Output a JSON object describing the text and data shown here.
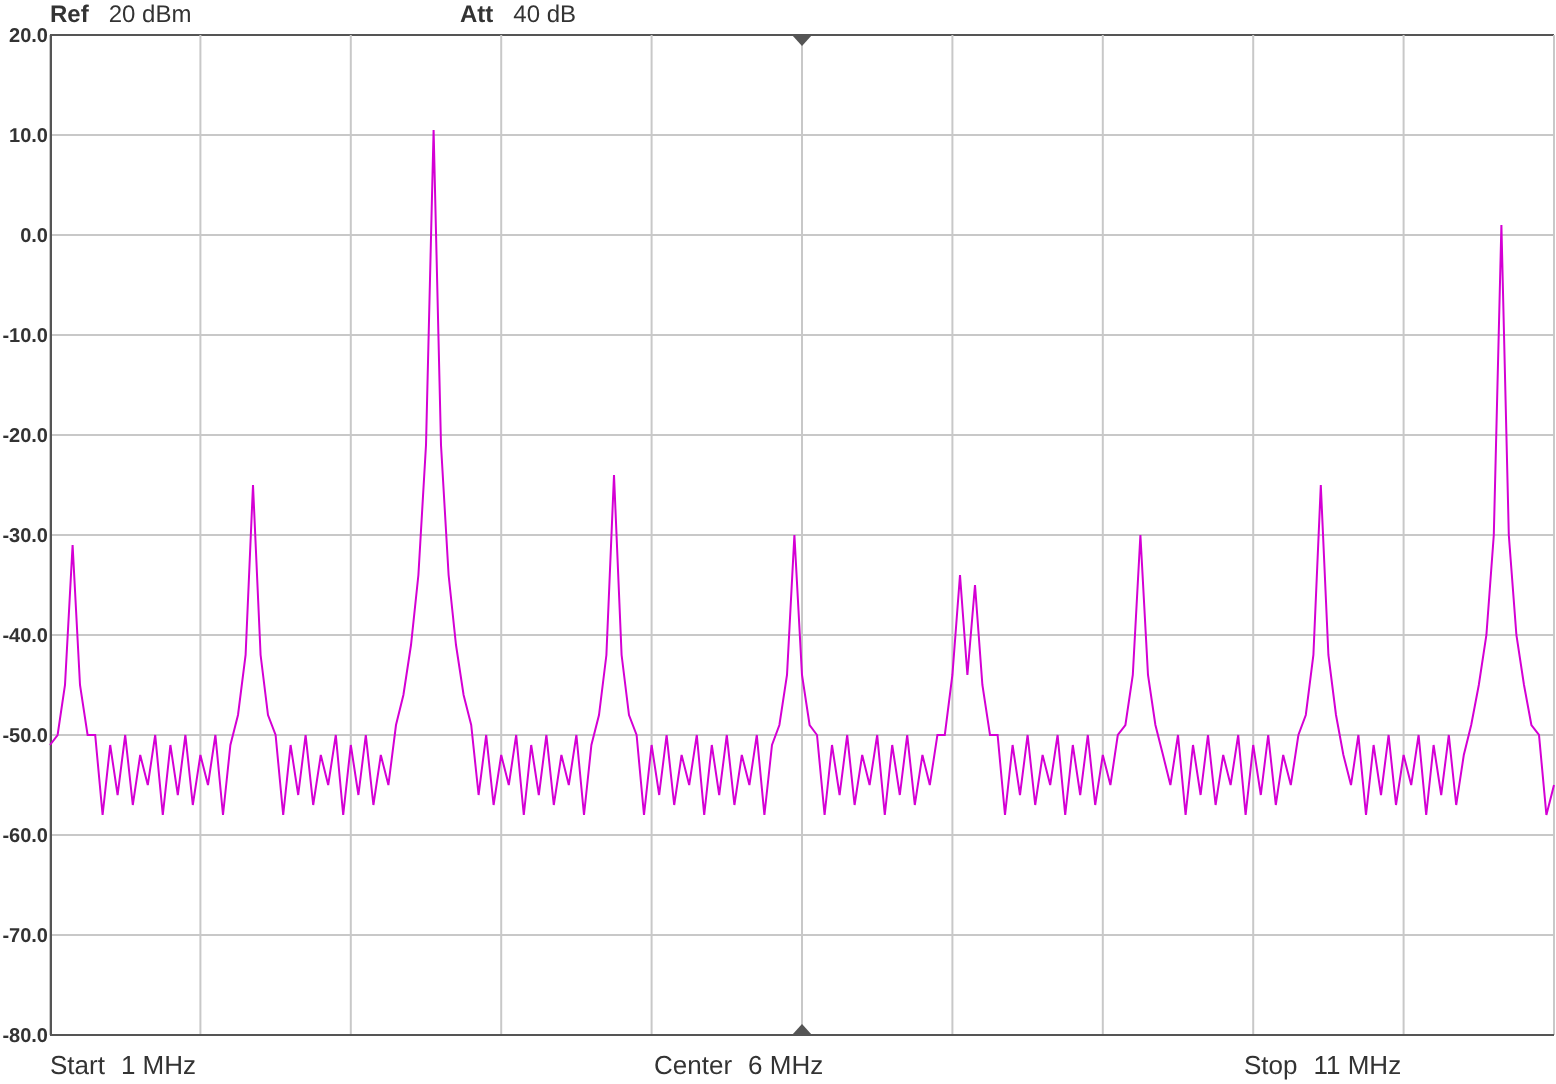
{
  "header": [
    {
      "label": "Ref",
      "value": "20 dBm"
    },
    {
      "label": "Att",
      "value": "40 dB"
    }
  ],
  "spectrum": {
    "chart_data": {
      "type": "line",
      "grid": true,
      "ylim": [
        -80,
        20
      ],
      "yticks": [
        {
          "value": 20,
          "label": "20.0"
        },
        {
          "value": 10,
          "label": "10.0"
        },
        {
          "value": 0,
          "label": "0.0"
        },
        {
          "value": -10,
          "label": "-10.0"
        },
        {
          "value": -20,
          "label": "-20.0"
        },
        {
          "value": -30,
          "label": "-30.0"
        },
        {
          "value": -40,
          "label": "-40.0"
        },
        {
          "value": -50,
          "label": "-50.0"
        },
        {
          "value": -60,
          "label": "-60.0"
        },
        {
          "value": -70,
          "label": "-70.0"
        },
        {
          "value": -80,
          "label": "-80.0"
        }
      ],
      "categories": [
        null,
        null,
        null,
        null,
        null,
        null,
        null,
        null,
        null,
        null,
        null,
        null,
        null,
        null,
        null,
        null,
        null,
        null,
        null,
        null,
        null,
        null,
        null,
        null,
        null,
        null,
        null,
        null,
        null,
        null,
        null,
        null,
        null,
        null,
        null,
        null,
        null,
        null,
        null,
        null,
        null,
        null,
        null,
        null,
        null,
        null,
        null,
        null,
        null,
        null,
        null,
        null,
        null,
        null,
        null,
        null,
        null,
        null,
        null,
        null,
        null,
        null,
        null,
        null,
        null,
        null,
        null,
        null,
        null,
        null,
        null,
        null,
        null,
        null,
        null,
        null,
        null,
        null,
        null,
        null,
        null,
        null,
        null,
        null,
        null,
        null,
        null,
        null,
        null,
        null,
        null,
        null,
        null,
        null,
        null,
        null,
        null,
        null,
        null,
        null,
        null,
        null,
        null,
        null,
        null,
        null,
        null,
        null,
        null,
        null,
        null,
        null,
        null,
        null,
        null,
        null,
        null,
        null,
        null,
        null,
        null,
        null,
        null,
        null,
        null,
        null,
        null,
        null,
        null,
        null,
        null,
        null,
        null,
        null,
        null,
        null,
        null,
        null,
        null,
        null,
        null,
        null,
        null,
        null,
        null,
        null,
        null,
        null,
        null,
        null,
        null,
        null,
        null,
        null,
        null,
        null,
        null,
        null,
        null,
        null,
        null,
        null,
        null,
        null,
        null,
        null,
        null,
        null,
        null,
        null,
        null,
        null,
        null,
        null,
        null,
        null,
        null,
        null,
        null,
        null,
        null,
        null,
        null,
        null,
        null,
        null,
        null,
        null,
        null,
        null,
        null,
        null,
        null,
        null,
        null,
        null,
        null,
        null,
        null,
        null,
        null
      ],
      "series": [
        {
          "color": "#d400d4",
          "values": [
            -51,
            -50,
            -45,
            -31,
            -45,
            -50,
            -50,
            -58,
            -51,
            -56,
            -50,
            -57,
            -52,
            -55,
            -50,
            -58,
            -51,
            -56,
            -50,
            -57,
            -52,
            -55,
            -50,
            -58,
            -51,
            -48,
            -42,
            -25,
            -42,
            -48,
            -50,
            -58,
            -51,
            -56,
            -50,
            -57,
            -52,
            -55,
            -50,
            -58,
            -51,
            -56,
            -50,
            -57,
            -52,
            -55,
            -49,
            -46,
            -41,
            -34,
            -21,
            10.5,
            -21,
            -34,
            -41,
            -46,
            -49,
            -56,
            -50,
            -57,
            -52,
            -55,
            -50,
            -58,
            -51,
            -56,
            -50,
            -57,
            -52,
            -55,
            -50,
            -58,
            -51,
            -48,
            -42,
            -24,
            -42,
            -48,
            -50,
            -58,
            -51,
            -56,
            -50,
            -57,
            -52,
            -55,
            -50,
            -58,
            -51,
            -56,
            -50,
            -57,
            -52,
            -55,
            -50,
            -58,
            -51,
            -49,
            -44,
            -30,
            -44,
            -49,
            -50,
            -58,
            -51,
            -56,
            -50,
            -57,
            -52,
            -55,
            -50,
            -58,
            -51,
            -56,
            -50,
            -57,
            -52,
            -55,
            -50,
            -50,
            -44,
            -34,
            -44,
            -35,
            -45,
            -50,
            -50,
            -58,
            -51,
            -56,
            -50,
            -57,
            -52,
            -55,
            -50,
            -58,
            -51,
            -56,
            -50,
            -57,
            -52,
            -55,
            -50,
            -49,
            -44,
            -30,
            -44,
            -49,
            -52,
            -55,
            -50,
            -58,
            -51,
            -56,
            -50,
            -57,
            -52,
            -55,
            -50,
            -58,
            -51,
            -56,
            -50,
            -57,
            -52,
            -55,
            -50,
            -48,
            -42,
            -25,
            -42,
            -48,
            -52,
            -55,
            -50,
            -58,
            -51,
            -56,
            -50,
            -57,
            -52,
            -55,
            -50,
            -58,
            -51,
            -56,
            -50,
            -57,
            -52,
            -49,
            -45,
            -40,
            -30,
            1,
            -30,
            -40,
            -45,
            -49,
            -50,
            -58,
            -55
          ]
        }
      ]
    }
  },
  "footer": [
    {
      "label": "Start",
      "value": "1 MHz"
    },
    {
      "label": "Center",
      "value": "6 MHz"
    },
    {
      "label": "Stop",
      "value": "11 MHz"
    }
  ]
}
